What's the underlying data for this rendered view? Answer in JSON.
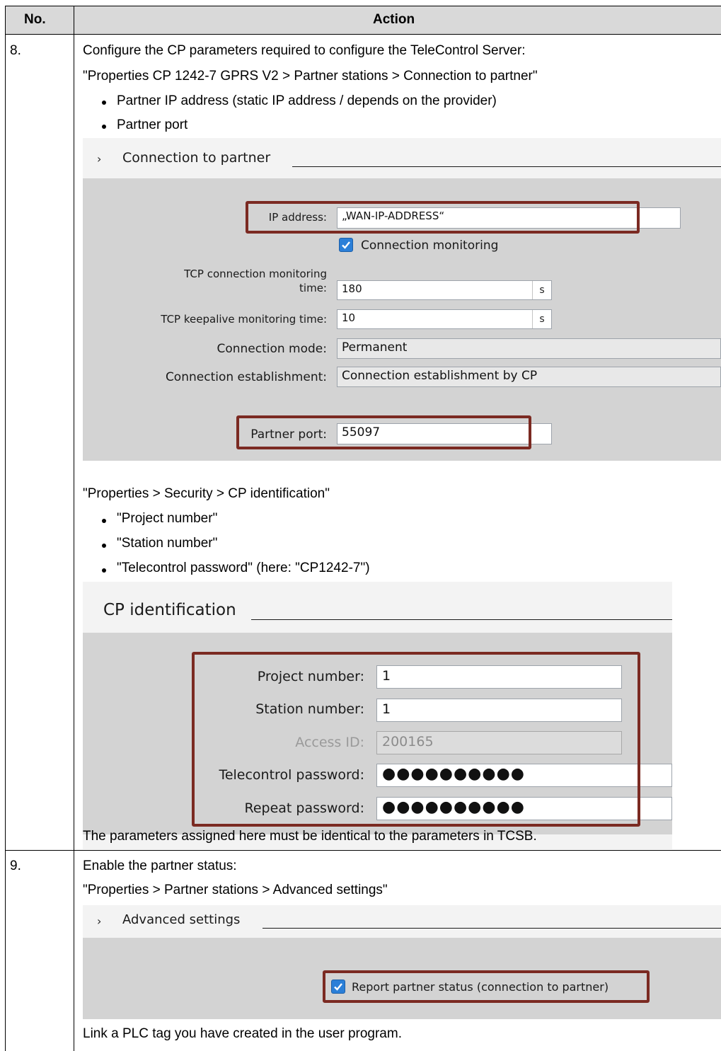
{
  "header": {
    "no_label": "No.",
    "action_label": "Action"
  },
  "steps": [
    {
      "number": "8.",
      "intro": "Configure the CP parameters required to configure the TeleControl Server:",
      "path": "\"Properties CP 1242-7 GPRS V2 > Partner stations > Connection to partner\"",
      "bullets": [
        "Partner IP address (static IP address / depends on the provider)",
        "Partner port"
      ],
      "connection_panel": {
        "title": "Connection to partner",
        "ip_label": "IP address:",
        "ip_value": "„WAN-IP-ADDRESS“",
        "monitoring_label": "Connection monitoring",
        "monitoring_checked": true,
        "tcp_conn_label_line1": "TCP connection monitoring",
        "tcp_conn_label_line2": "time:",
        "tcp_conn_value": "180",
        "tcp_conn_unit": "s",
        "keepalive_label": "TCP keepalive monitoring time:",
        "keepalive_value": "10",
        "keepalive_unit": "s",
        "mode_label": "Connection mode:",
        "mode_value": "Permanent",
        "establish_label": "Connection establishment:",
        "establish_value": "Connection establishment by CP",
        "port_label": "Partner port:",
        "port_value": "55097"
      },
      "security_path": "\"Properties > Security > CP identification\"",
      "security_bullets": [
        "\"Project number\"",
        "\"Station number\"",
        "\"Telecontrol password\" (here: \"CP1242-7\")"
      ],
      "identification_panel": {
        "title": "CP identification",
        "project_label": "Project number:",
        "project_value": "1",
        "station_label": "Station number:",
        "station_value": "1",
        "access_label": "Access ID:",
        "access_value": "200165",
        "password_label": "Telecontrol password:",
        "password_value": "●●●●●●●●●●",
        "repeat_label": "Repeat password:",
        "repeat_value": "●●●●●●●●●●"
      },
      "note": "The parameters assigned here must be identical to the parameters in TCSB."
    },
    {
      "number": "9.",
      "intro": "Enable the partner status:",
      "path": "\"Properties > Partner stations > Advanced settings\"",
      "advanced_panel": {
        "title": "Advanced settings",
        "report_label": "Report partner status (connection to partner)",
        "report_checked": true
      },
      "note": "Link a PLC tag you have created in the user program."
    }
  ],
  "colors": {
    "highlight": "#7b2a22",
    "checkbox": "#2b7fd8",
    "panel": "#d3d3d3",
    "header": "#d9d9d9"
  }
}
